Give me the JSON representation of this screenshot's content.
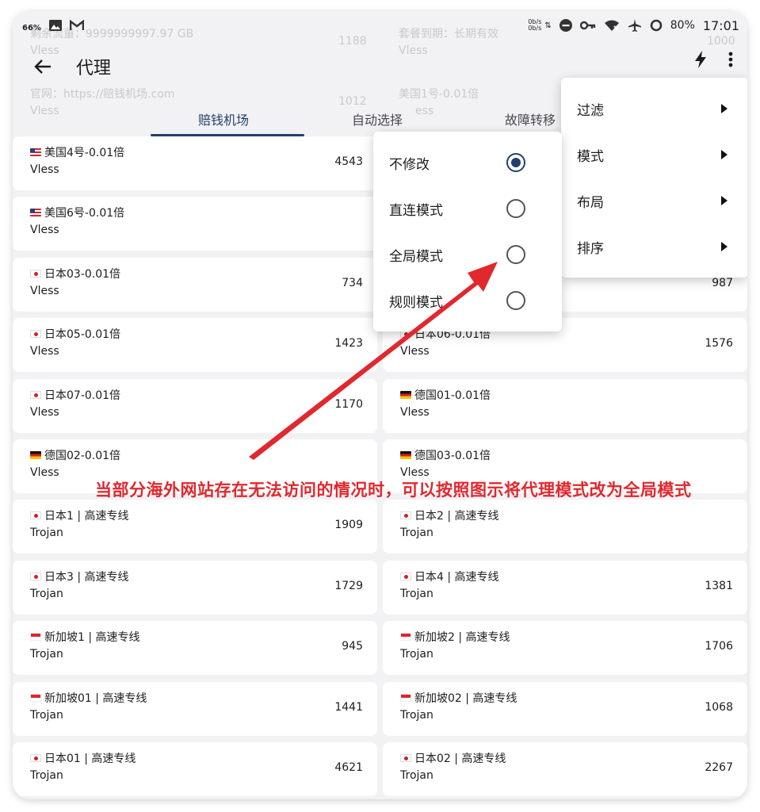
{
  "status_bar": {
    "left_badge": "66%",
    "speed_up": "0b/s",
    "speed_down": "0b/s",
    "battery": "80%",
    "time": "17:01"
  },
  "background_text": {
    "line1_left": "剩余流量：9999999997.97 GB",
    "line1_mid": "1188",
    "line1_right": "套餐到期：长期有效",
    "line1_far": "1000",
    "line2_left": "Vless",
    "line2_right": "Vless",
    "line3_left": "官网：https://赔钱机场.com",
    "line3_right": "美国1号-0.01倍",
    "line4_left": "Vless",
    "line4_mid": "1012",
    "line4_right": "ess"
  },
  "toolbar": {
    "title": "代理"
  },
  "tabs": [
    "赔钱机场",
    "自动选择",
    "故障转移"
  ],
  "proxies": [
    {
      "name": "美国4号-0.01倍",
      "flag": "us",
      "proto": "Vless",
      "latency": "4543"
    },
    {
      "name": "",
      "flag": "",
      "proto": "",
      "latency": ""
    },
    {
      "name": "美国6号-0.01倍",
      "flag": "us",
      "proto": "Vless",
      "latency": ""
    },
    {
      "name": "",
      "flag": "",
      "proto": "",
      "latency": ""
    },
    {
      "name": "日本03-0.01倍",
      "flag": "jp",
      "proto": "Vless",
      "latency": "734"
    },
    {
      "name": "",
      "flag": "",
      "proto": "",
      "latency": "987"
    },
    {
      "name": "日本05-0.01倍",
      "flag": "jp",
      "proto": "Vless",
      "latency": "1423"
    },
    {
      "name": "日本06-0.01倍",
      "flag": "jp",
      "proto": "Vless",
      "latency": "1576"
    },
    {
      "name": "日本07-0.01倍",
      "flag": "jp",
      "proto": "Vless",
      "latency": "1170"
    },
    {
      "name": "德国01-0.01倍",
      "flag": "de",
      "proto": "Vless",
      "latency": ""
    },
    {
      "name": "德国02-0.01倍",
      "flag": "de",
      "proto": "Vless",
      "latency": ""
    },
    {
      "name": "德国03-0.01倍",
      "flag": "de",
      "proto": "Vless",
      "latency": ""
    },
    {
      "name": "日本1 | 高速专线",
      "flag": "jp",
      "proto": "Trojan",
      "latency": "1909"
    },
    {
      "name": "日本2 | 高速专线",
      "flag": "jp",
      "proto": "Trojan",
      "latency": ""
    },
    {
      "name": "日本3 | 高速专线",
      "flag": "jp",
      "proto": "Trojan",
      "latency": "1729"
    },
    {
      "name": "日本4 | 高速专线",
      "flag": "jp",
      "proto": "Trojan",
      "latency": "1381"
    },
    {
      "name": "新加坡1 | 高速专线",
      "flag": "sg",
      "proto": "Trojan",
      "latency": "945"
    },
    {
      "name": "新加坡2 | 高速专线",
      "flag": "sg",
      "proto": "Trojan",
      "latency": "1706"
    },
    {
      "name": "新加坡01 | 高速专线",
      "flag": "sg",
      "proto": "Trojan",
      "latency": "1441"
    },
    {
      "name": "新加坡02 | 高速专线",
      "flag": "sg",
      "proto": "Trojan",
      "latency": "1068"
    },
    {
      "name": "日本01 | 高速专线",
      "flag": "jp",
      "proto": "Trojan",
      "latency": "4621"
    },
    {
      "name": "日本02 | 高速专线",
      "flag": "jp",
      "proto": "Trojan",
      "latency": "2267"
    }
  ],
  "mode_menu": {
    "items": [
      "不修改",
      "直连模式",
      "全局模式",
      "规则模式"
    ],
    "selected_index": 0
  },
  "overflow_menu": {
    "items": [
      "过滤",
      "模式",
      "布局",
      "排序"
    ]
  },
  "annotation": {
    "text": "当部分海外网站存在无法访问的情况时，可以按照图示将代理模式改为全局模式",
    "color": "#e0282e"
  },
  "colors": {
    "accent": "#22406e",
    "background": "#f2f2f4",
    "card": "#ffffff"
  }
}
